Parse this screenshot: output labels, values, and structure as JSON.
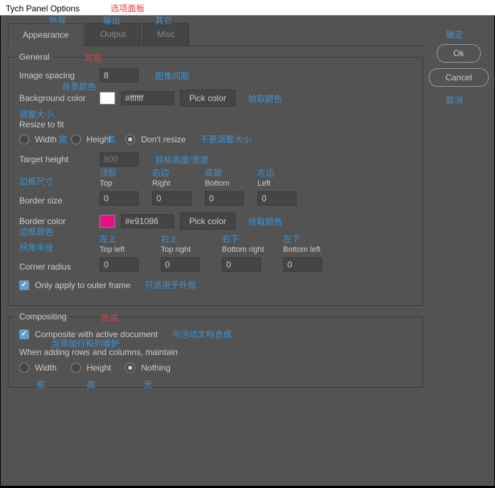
{
  "title": "Tych Panel Options",
  "title_zh": "选项面板",
  "tabs": {
    "appearance": "Appearance",
    "output": "Output",
    "misc": "Misc"
  },
  "tabs_zh": {
    "appearance": "外观",
    "output": "输出",
    "misc": "其它"
  },
  "buttons": {
    "ok": "Ok",
    "cancel": "Cancel",
    "pick": "Pick color"
  },
  "buttons_zh": {
    "ok": "确定",
    "cancel": "取消",
    "pick": "拾取颜色"
  },
  "general": {
    "legend": "General",
    "legend_zh": "常规",
    "spacing_label": "Image spacing",
    "spacing_val": "8",
    "spacing_zh": "图像间距",
    "bg_label": "Background color",
    "bg_label_zh": "背景颜色",
    "bg_hex": "#ffffff",
    "bg_swatch": "#ffffff",
    "resize_head": "Resize to fit",
    "resize_head_zh": "调整大小",
    "r_width": "Width",
    "r_width_zh": "宽",
    "r_height": "Height",
    "r_height_zh": "高",
    "r_none": "Don't resize",
    "r_none_zh": "不要调整大小",
    "target_label": "Target height",
    "target_val": "800",
    "target_zh": "目标高度/宽度",
    "border_label": "Border size",
    "border_label_zh": "边框尺寸",
    "col_top": "Top",
    "col_top_zh": "顶部",
    "col_right": "Right",
    "col_right_zh": "右边",
    "col_bottom": "Bottom",
    "col_bottom_zh": "底部",
    "col_left": "Left",
    "col_left_zh": "左边",
    "b_top": "0",
    "b_right": "0",
    "b_bottom": "0",
    "b_left": "0",
    "bcolor_label": "Border color",
    "bcolor_label_zh": "边框颜色",
    "bcolor_hex": "#e91086",
    "bcolor_swatch": "#e91086",
    "radius_label": "Corner radius",
    "radius_label_zh": "拐角半径",
    "c_tl": "Top left",
    "c_tl_zh": "左上",
    "c_tr": "Top right",
    "c_tr_zh": "右上",
    "c_br": "Bottom right",
    "c_br_zh": "右下",
    "c_bl": "Bottom left",
    "c_bl_zh": "左下",
    "r_tl": "0",
    "r_tr": "0",
    "r_br": "0",
    "r_bl": "0",
    "outer_label": "Only apply to outer frame",
    "outer_zh": "只适用于外框"
  },
  "comp": {
    "legend": "Compositing",
    "legend_zh": "合成",
    "active_label": "Composite with active document",
    "active_zh": "与活动文档合成",
    "maintain_head": "When adding rows and columns, maintain",
    "maintain_zh": "当添加行和列维护",
    "m_width": "Width",
    "m_width_zh": "宽",
    "m_height": "Height",
    "m_height_zh": "高",
    "m_nothing": "Nothing",
    "m_nothing_zh": "无"
  }
}
